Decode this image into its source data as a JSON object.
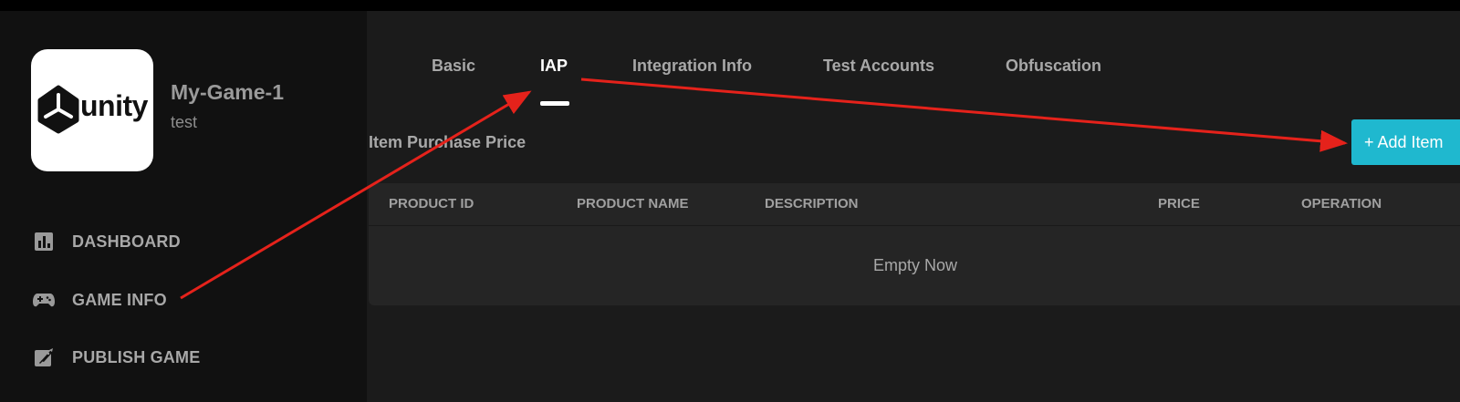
{
  "app": {
    "logo_text": "unity",
    "title": "My-Game-1",
    "subtitle": "test"
  },
  "sidebar": {
    "items": [
      {
        "label": "DASHBOARD",
        "icon": "bar-chart-icon"
      },
      {
        "label": "GAME INFO",
        "icon": "gamepad-icon"
      },
      {
        "label": "PUBLISH GAME",
        "icon": "rocket-icon"
      }
    ]
  },
  "tabs": [
    {
      "label": "Basic",
      "active": false
    },
    {
      "label": "IAP",
      "active": true
    },
    {
      "label": "Integration Info",
      "active": false
    },
    {
      "label": "Test Accounts",
      "active": false
    },
    {
      "label": "Obfuscation",
      "active": false
    }
  ],
  "section": {
    "title": "Item Purchase Price",
    "add_button_label": "+ Add Item"
  },
  "table": {
    "columns": [
      "PRODUCT ID",
      "PRODUCT NAME",
      "DESCRIPTION",
      "PRICE",
      "OPERATION"
    ],
    "rows": [],
    "empty_text": "Empty Now"
  },
  "colors": {
    "accent": "#1fb8cf",
    "annotation_arrow": "#e5221b",
    "background": "#1b1b1b",
    "sidebar": "#111111"
  }
}
